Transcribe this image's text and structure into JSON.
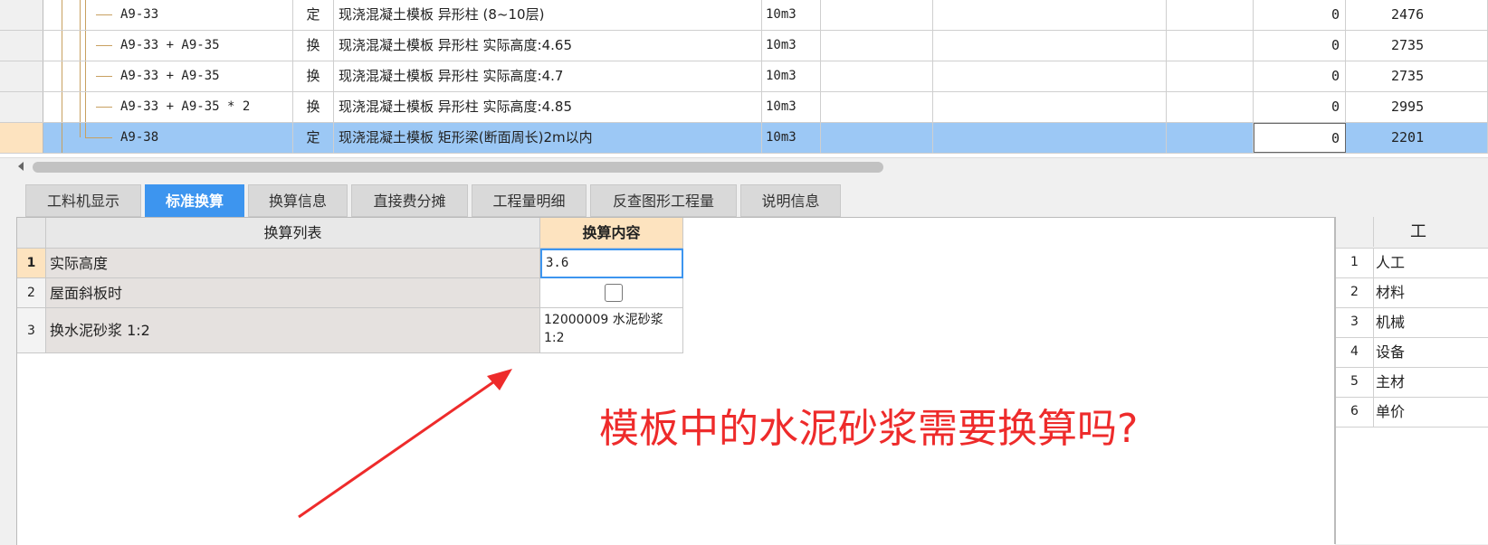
{
  "grid": {
    "rows": [
      {
        "code": "A9-33",
        "type": "定",
        "name": "现浇混凝土模板 异形柱 (8~10层)",
        "unit": "10m3",
        "qty": "0",
        "price": "2476",
        "selected": false
      },
      {
        "code": "A9-33 + A9-35",
        "type": "换",
        "name": "现浇混凝土模板 异形柱  实际高度:4.65",
        "unit": "10m3",
        "qty": "0",
        "price": "2735",
        "selected": false
      },
      {
        "code": "A9-33 + A9-35",
        "type": "换",
        "name": "现浇混凝土模板 异形柱  实际高度:4.7",
        "unit": "10m3",
        "qty": "0",
        "price": "2735",
        "selected": false
      },
      {
        "code": "A9-33 + A9-35 * 2",
        "type": "换",
        "name": "现浇混凝土模板 异形柱  实际高度:4.85",
        "unit": "10m3",
        "qty": "0",
        "price": "2995",
        "selected": false
      },
      {
        "code": "A9-38",
        "type": "定",
        "name": "现浇混凝土模板 矩形梁(断面周长)2m以内",
        "unit": "10m3",
        "qty": "0",
        "price": "2201",
        "selected": true
      }
    ]
  },
  "tabs": [
    {
      "label": "工料机显示",
      "active": false
    },
    {
      "label": "标准换算",
      "active": true
    },
    {
      "label": "换算信息",
      "active": false
    },
    {
      "label": "直接费分摊",
      "active": false
    },
    {
      "label": "工程量明细",
      "active": false
    },
    {
      "label": "反查图形工程量",
      "active": false
    },
    {
      "label": "说明信息",
      "active": false
    }
  ],
  "conversion": {
    "header_list": "换算列表",
    "header_content": "换算内容",
    "rows": [
      {
        "num": "1",
        "name": "实际高度",
        "value": "3.6"
      },
      {
        "num": "2",
        "name": "屋面斜板时",
        "value": ""
      },
      {
        "num": "3",
        "name": "换水泥砂浆 1:2",
        "value": "12000009  水泥砂浆 1:2"
      }
    ]
  },
  "right_panel": {
    "header": "工",
    "rows": [
      {
        "num": "1",
        "label": "人工"
      },
      {
        "num": "2",
        "label": "材料"
      },
      {
        "num": "3",
        "label": "机械"
      },
      {
        "num": "4",
        "label": "设备"
      },
      {
        "num": "5",
        "label": "主材"
      },
      {
        "num": "6",
        "label": "单价"
      }
    ]
  },
  "annotation": {
    "text": "模板中的水泥砂浆需要换算吗?",
    "color": "#ee2b2b"
  },
  "colors": {
    "selected_row": "#9cc8f5",
    "active_tab": "#3d95ef",
    "content_header": "#fde3bf"
  }
}
